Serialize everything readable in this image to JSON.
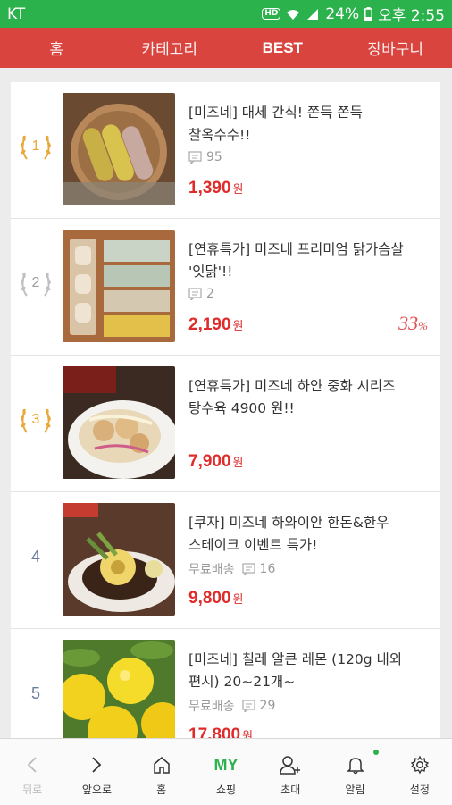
{
  "status": {
    "carrier": "KT",
    "hd": "HD",
    "battery": "24%",
    "time": "오후 2:55"
  },
  "nav": {
    "tabs": [
      "홈",
      "카테고리",
      "BEST",
      "장바구니"
    ],
    "active": "BEST"
  },
  "items": [
    {
      "rank": "1",
      "title": "[미즈네] 대세 간식! 쫀득 쫀득 찰옥수수!!",
      "shipping": "",
      "comments": "95",
      "price": "1,390",
      "won": "원",
      "discount": ""
    },
    {
      "rank": "2",
      "title": "[연휴특가] 미즈네 프리미엄 닭가슴살 '잇닭'!!",
      "shipping": "",
      "comments": "2",
      "price": "2,190",
      "won": "원",
      "discount": "33",
      "discount_unit": "%"
    },
    {
      "rank": "3",
      "title": "[연휴특가] 미즈네 하얀 중화 시리즈 탕수육 4900 원!!",
      "shipping": "",
      "comments": "",
      "price": "7,900",
      "won": "원",
      "discount": ""
    },
    {
      "rank": "4",
      "title": "[쿠자] 미즈네 하와이안 한돈&한우 스테이크 이벤트 특가!",
      "shipping": "무료배송",
      "comments": "16",
      "price": "9,800",
      "won": "원",
      "discount": ""
    },
    {
      "rank": "5",
      "title": "[미즈네] 칠레 알큰 레몬 (120g 내외 편시) 20~21개~",
      "shipping": "무료배송",
      "comments": "29",
      "price": "17,800",
      "won": "원",
      "discount": ""
    }
  ],
  "bottom": {
    "back": "뒤로",
    "forward": "앞으로",
    "home": "홈",
    "my": "MY",
    "shopping": "쇼핑",
    "invite": "초대",
    "alerts": "알림",
    "settings": "설정"
  },
  "colors": {
    "statusbar": "#2bb24c",
    "navbar": "#d9443f",
    "price": "#e02b2b",
    "gold": "#e8a93a",
    "silver": "#bfbfbf"
  }
}
